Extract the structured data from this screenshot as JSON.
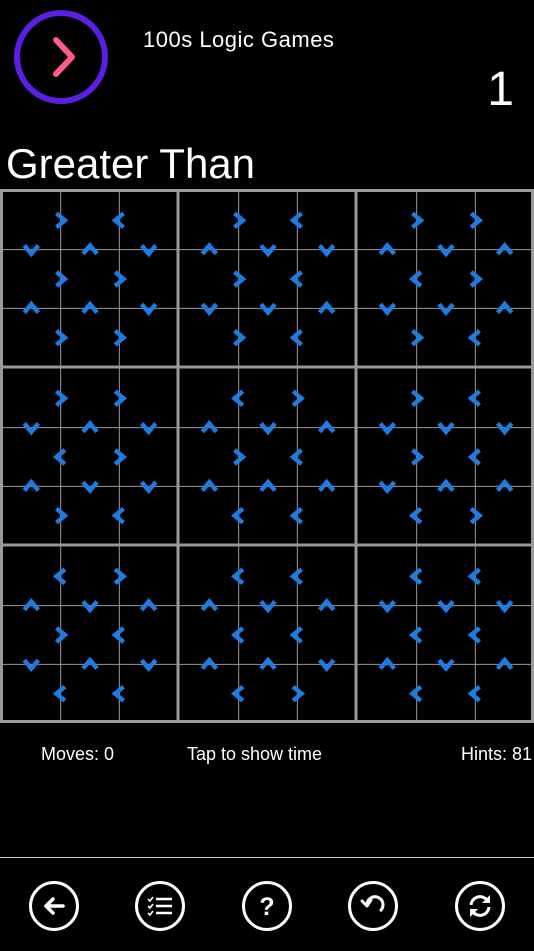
{
  "header": {
    "app_name": "100s Logic Games",
    "level": "1",
    "title": "Greater Than",
    "logo_color": "#5a1fe0",
    "logo_arrow_color": "#ff5a8a"
  },
  "puzzle": {
    "size": 9,
    "arrow_color": "#1e7be0",
    "grid_color": "#9a9a9a",
    "row_arrows": [
      [
        "R",
        "L",
        "R",
        "L",
        "R",
        "R"
      ],
      [
        "R",
        "R",
        "R",
        "L",
        "L",
        "R"
      ],
      [
        "R",
        "R",
        "R",
        "L",
        "R",
        "L"
      ],
      [
        "R",
        "R",
        "L",
        "R",
        "R",
        "L"
      ],
      [
        "L",
        "R",
        "R",
        "L",
        "R",
        "L"
      ],
      [
        "R",
        "L",
        "L",
        "L",
        "L",
        "R"
      ],
      [
        "L",
        "R",
        "L",
        "L",
        "L",
        "L"
      ],
      [
        "R",
        "L",
        "L",
        "L",
        "L",
        "L"
      ],
      [
        "L",
        "L",
        "L",
        "R",
        "L",
        "L"
      ]
    ],
    "col_arrows": [
      [
        "D",
        "U",
        "D",
        "U",
        "D",
        "D",
        "U",
        "D",
        "U"
      ],
      [
        "U",
        "U",
        "D",
        "D",
        "D",
        "U",
        "D",
        "D",
        "U"
      ],
      [
        "D",
        "U",
        "D",
        "U",
        "D",
        "U",
        "D",
        "D",
        "D"
      ],
      [
        "U",
        "D",
        "D",
        "U",
        "U",
        "U",
        "D",
        "U",
        "U"
      ],
      [
        "U",
        "D",
        "U",
        "U",
        "D",
        "U",
        "D",
        "D",
        "D"
      ],
      [
        "D",
        "U",
        "D",
        "U",
        "U",
        "D",
        "U",
        "D",
        "U"
      ]
    ]
  },
  "status": {
    "moves": "Moves: 0",
    "timer": "Tap to show time",
    "hints": "Hints: 81"
  },
  "toolbar": {
    "items": [
      "back-arrow-icon",
      "list-icon",
      "help-icon",
      "undo-icon",
      "refresh-icon"
    ]
  }
}
